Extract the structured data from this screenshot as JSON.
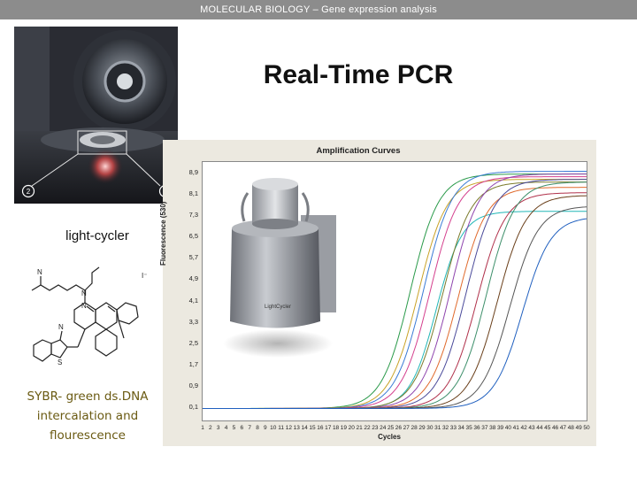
{
  "header": {
    "text": "MOLECULAR BIOLOGY  –  Gene expression analysis"
  },
  "title": "Real-Time PCR",
  "photo": {
    "callout_1": "1",
    "callout_2": "2"
  },
  "caption_lightcycler": "light-cycler",
  "caption_sybr": "SYBR- green ds.DNA intercalation and flourescence",
  "chart": {
    "title": "Amplification Curves",
    "ylabel": "Fluorescence (530)",
    "xlabel": "Cycles",
    "device_label": "LightCycler"
  },
  "chart_data": {
    "type": "line",
    "title": "Amplification Curves",
    "xlabel": "Cycles",
    "ylabel": "Fluorescence (530)",
    "xlim": [
      1,
      50
    ],
    "ylim": [
      -0.4,
      9.3
    ],
    "x_ticks": [
      1,
      2,
      3,
      4,
      5,
      6,
      7,
      8,
      9,
      10,
      11,
      12,
      13,
      14,
      15,
      16,
      17,
      18,
      19,
      20,
      21,
      22,
      23,
      24,
      25,
      26,
      27,
      28,
      29,
      30,
      31,
      32,
      33,
      34,
      35,
      36,
      37,
      38,
      39,
      40,
      41,
      42,
      43,
      44,
      45,
      46,
      47,
      48,
      49,
      50
    ],
    "y_ticks": [
      "0,1",
      "0,9",
      "1,7",
      "2,5",
      "3,3",
      "4,1",
      "4,9",
      "5,7",
      "6,5",
      "7,3",
      "8,1",
      "8,9"
    ],
    "y_tick_values": [
      0.1,
      0.9,
      1.7,
      2.5,
      3.3,
      4.1,
      4.9,
      5.7,
      6.5,
      7.3,
      8.1,
      8.9
    ],
    "series": [
      {
        "color": "#2a9a4a",
        "midpoint": 27.5,
        "plateau": 8.8,
        "k": 0.55
      },
      {
        "color": "#c9a227",
        "midpoint": 28.5,
        "plateau": 8.6,
        "k": 0.55
      },
      {
        "color": "#3a7bd5",
        "midpoint": 29.2,
        "plateau": 8.9,
        "k": 0.55
      },
      {
        "color": "#d43f8d",
        "midpoint": 30.0,
        "plateau": 8.7,
        "k": 0.55
      },
      {
        "color": "#20b6b6",
        "midpoint": 30.8,
        "plateau": 7.4,
        "k": 0.6
      },
      {
        "color": "#7a7a2a",
        "midpoint": 31.6,
        "plateau": 8.5,
        "k": 0.55
      },
      {
        "color": "#8e44ad",
        "midpoint": 32.6,
        "plateau": 8.8,
        "k": 0.55
      },
      {
        "color": "#e06a2c",
        "midpoint": 33.6,
        "plateau": 8.3,
        "k": 0.55
      },
      {
        "color": "#4a4a9a",
        "midpoint": 34.6,
        "plateau": 8.6,
        "k": 0.55
      },
      {
        "color": "#b0304a",
        "midpoint": 36.0,
        "plateau": 8.1,
        "k": 0.55
      },
      {
        "color": "#3d8f6a",
        "midpoint": 37.2,
        "plateau": 8.5,
        "k": 0.55
      },
      {
        "color": "#6a3f1a",
        "midpoint": 38.6,
        "plateau": 8.0,
        "k": 0.55
      },
      {
        "color": "#555555",
        "midpoint": 40.2,
        "plateau": 7.6,
        "k": 0.55
      },
      {
        "color": "#1f5fbf",
        "midpoint": 41.8,
        "plateau": 7.2,
        "k": 0.55
      }
    ]
  }
}
